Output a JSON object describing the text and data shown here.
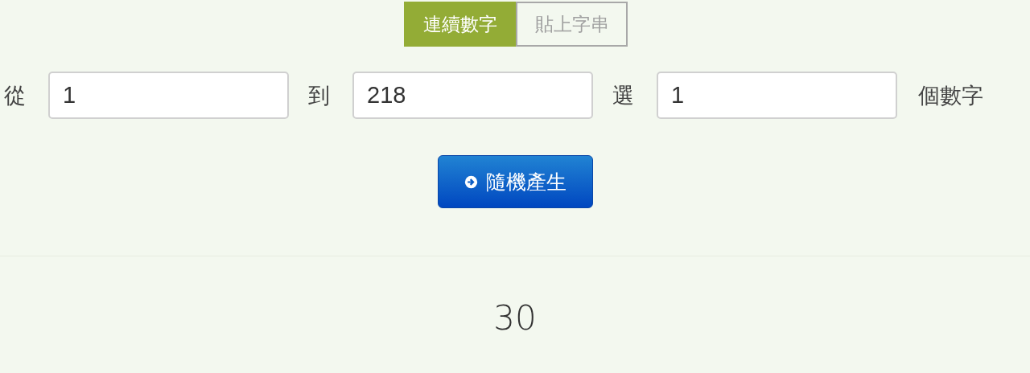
{
  "tabs": [
    {
      "label": "連續數字",
      "selected": true
    },
    {
      "label": "貼上字串",
      "selected": false
    }
  ],
  "range": [
    {
      "label": "從",
      "value": "1"
    },
    {
      "label": "到",
      "value": "218"
    },
    {
      "label": "選",
      "value": "1"
    }
  ],
  "suffix": "個數字",
  "button": {
    "label": "隨機產生"
  },
  "result": "30"
}
